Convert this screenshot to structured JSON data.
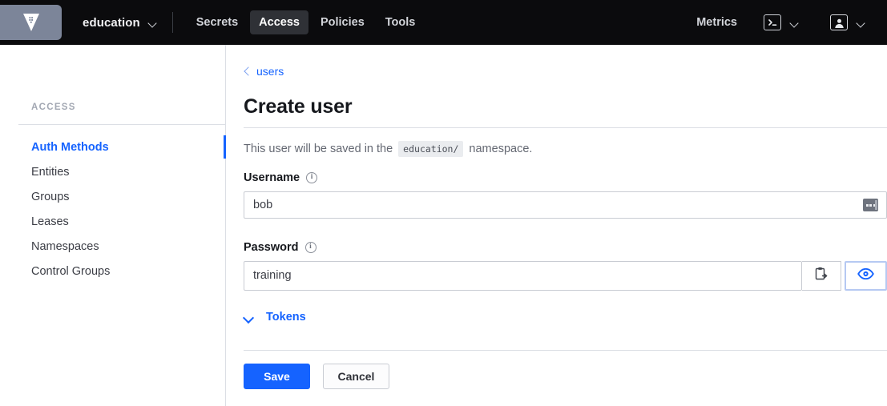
{
  "navbar": {
    "logo_icon": "vault-logo-icon",
    "namespace": "education",
    "namespace_chevron_icon": "chevron-down-icon",
    "links": [
      {
        "label": "Secrets",
        "active": false
      },
      {
        "label": "Access",
        "active": true
      },
      {
        "label": "Policies",
        "active": false
      },
      {
        "label": "Tools",
        "active": false
      }
    ],
    "metrics_label": "Metrics",
    "console_icon": "terminal-console-icon",
    "console_chevron_icon": "chevron-down-icon",
    "user_icon": "user-avatar-icon",
    "user_chevron_icon": "chevron-down-icon"
  },
  "sidebar": {
    "section_title": "ACCESS",
    "items": [
      {
        "label": "Auth Methods",
        "active": true
      },
      {
        "label": "Entities",
        "active": false
      },
      {
        "label": "Groups",
        "active": false
      },
      {
        "label": "Leases",
        "active": false
      },
      {
        "label": "Namespaces",
        "active": false
      },
      {
        "label": "Control Groups",
        "active": false
      }
    ]
  },
  "main": {
    "breadcrumb": {
      "icon": "chevron-left-icon",
      "label": "users"
    },
    "title": "Create user",
    "namespace_note": {
      "prefix": "This user will be saved in the",
      "badge": "education/",
      "suffix": "namespace."
    },
    "username_field": {
      "label": "Username",
      "info_icon": "info-circle-icon",
      "value": "bob",
      "placeholder": "",
      "autofill_icon": "password-manager-autofill-icon"
    },
    "password_field": {
      "label": "Password",
      "info_icon": "info-circle-icon",
      "value": "training",
      "placeholder": "",
      "copy_icon": "clipboard-copy-icon",
      "reveal_icon": "eye-icon"
    },
    "tokens_toggle": {
      "icon": "chevron-down-icon",
      "label": "Tokens"
    },
    "save_label": "Save",
    "cancel_label": "Cancel"
  },
  "colors": {
    "accent_blue": "#1563ff",
    "navbar_bg": "#0b0b0d",
    "logo_tile": "#7c8599"
  }
}
